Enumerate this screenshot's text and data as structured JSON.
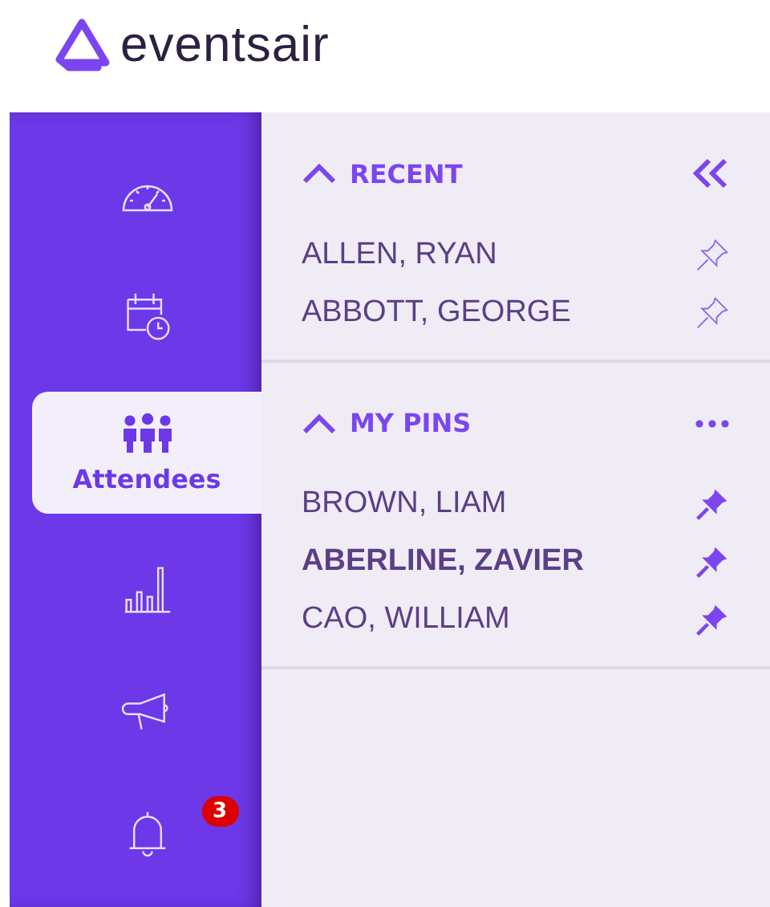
{
  "logo": {
    "text": "eventsair"
  },
  "nav": [
    {
      "kind": "dashboard",
      "selected": false
    },
    {
      "kind": "calendar",
      "selected": false
    },
    {
      "kind": "attendees",
      "selected": true,
      "label": "Attendees"
    },
    {
      "kind": "reports",
      "selected": false
    },
    {
      "kind": "marketing",
      "selected": false
    },
    {
      "kind": "notifications",
      "selected": false,
      "badge": "3"
    }
  ],
  "sections": [
    {
      "title": "RECENT",
      "expanded": true,
      "kind": "collapsible",
      "items": [
        {
          "name": "ALLEN, RYAN",
          "selected": false,
          "pinned": false
        },
        {
          "name": "ABBOTT, GEORGE",
          "selected": false,
          "pinned": false
        }
      ]
    },
    {
      "title": "MY PINS",
      "expanded": true,
      "kind": "menu",
      "items": [
        {
          "name": "BROWN, LIAM",
          "selected": false,
          "pinned": true
        },
        {
          "name": "ABERLINE, ZAVIER",
          "selected": true,
          "pinned": true
        },
        {
          "name": "CAO, WILLIAM",
          "selected": false,
          "pinned": true
        }
      ]
    }
  ]
}
